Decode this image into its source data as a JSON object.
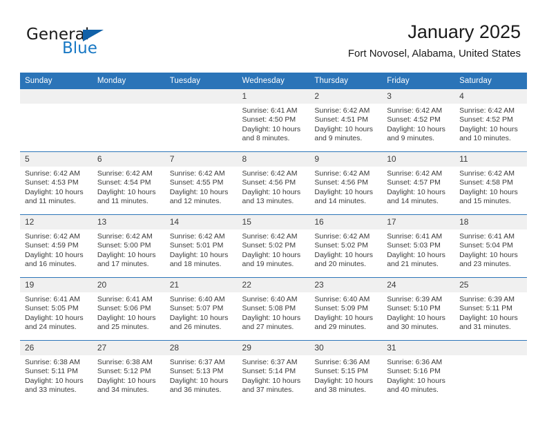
{
  "brand": {
    "name_part1": "General",
    "name_part2": "Blue",
    "flag_icon": "triangle-flag-icon",
    "accent_color": "#1878c4"
  },
  "header": {
    "title": "January 2025",
    "subtitle": "Fort Novosel, Alabama, United States"
  },
  "theme": {
    "header_row_bg": "#2b74b8",
    "daynum_bg": "#f0f0f0",
    "text_color": "#3a3a3a"
  },
  "calendar": {
    "weekday_headers": [
      "Sunday",
      "Monday",
      "Tuesday",
      "Wednesday",
      "Thursday",
      "Friday",
      "Saturday"
    ],
    "weeks": [
      [
        {
          "day": "",
          "sunrise": "",
          "sunset": "",
          "daylight_line1": "",
          "daylight_line2": "",
          "empty": true
        },
        {
          "day": "",
          "sunrise": "",
          "sunset": "",
          "daylight_line1": "",
          "daylight_line2": "",
          "empty": true
        },
        {
          "day": "",
          "sunrise": "",
          "sunset": "",
          "daylight_line1": "",
          "daylight_line2": "",
          "empty": true
        },
        {
          "day": "1",
          "sunrise": "Sunrise: 6:41 AM",
          "sunset": "Sunset: 4:50 PM",
          "daylight_line1": "Daylight: 10 hours",
          "daylight_line2": "and 8 minutes."
        },
        {
          "day": "2",
          "sunrise": "Sunrise: 6:42 AM",
          "sunset": "Sunset: 4:51 PM",
          "daylight_line1": "Daylight: 10 hours",
          "daylight_line2": "and 9 minutes."
        },
        {
          "day": "3",
          "sunrise": "Sunrise: 6:42 AM",
          "sunset": "Sunset: 4:52 PM",
          "daylight_line1": "Daylight: 10 hours",
          "daylight_line2": "and 9 minutes."
        },
        {
          "day": "4",
          "sunrise": "Sunrise: 6:42 AM",
          "sunset": "Sunset: 4:52 PM",
          "daylight_line1": "Daylight: 10 hours",
          "daylight_line2": "and 10 minutes."
        }
      ],
      [
        {
          "day": "5",
          "sunrise": "Sunrise: 6:42 AM",
          "sunset": "Sunset: 4:53 PM",
          "daylight_line1": "Daylight: 10 hours",
          "daylight_line2": "and 11 minutes."
        },
        {
          "day": "6",
          "sunrise": "Sunrise: 6:42 AM",
          "sunset": "Sunset: 4:54 PM",
          "daylight_line1": "Daylight: 10 hours",
          "daylight_line2": "and 11 minutes."
        },
        {
          "day": "7",
          "sunrise": "Sunrise: 6:42 AM",
          "sunset": "Sunset: 4:55 PM",
          "daylight_line1": "Daylight: 10 hours",
          "daylight_line2": "and 12 minutes."
        },
        {
          "day": "8",
          "sunrise": "Sunrise: 6:42 AM",
          "sunset": "Sunset: 4:56 PM",
          "daylight_line1": "Daylight: 10 hours",
          "daylight_line2": "and 13 minutes."
        },
        {
          "day": "9",
          "sunrise": "Sunrise: 6:42 AM",
          "sunset": "Sunset: 4:56 PM",
          "daylight_line1": "Daylight: 10 hours",
          "daylight_line2": "and 14 minutes."
        },
        {
          "day": "10",
          "sunrise": "Sunrise: 6:42 AM",
          "sunset": "Sunset: 4:57 PM",
          "daylight_line1": "Daylight: 10 hours",
          "daylight_line2": "and 14 minutes."
        },
        {
          "day": "11",
          "sunrise": "Sunrise: 6:42 AM",
          "sunset": "Sunset: 4:58 PM",
          "daylight_line1": "Daylight: 10 hours",
          "daylight_line2": "and 15 minutes."
        }
      ],
      [
        {
          "day": "12",
          "sunrise": "Sunrise: 6:42 AM",
          "sunset": "Sunset: 4:59 PM",
          "daylight_line1": "Daylight: 10 hours",
          "daylight_line2": "and 16 minutes."
        },
        {
          "day": "13",
          "sunrise": "Sunrise: 6:42 AM",
          "sunset": "Sunset: 5:00 PM",
          "daylight_line1": "Daylight: 10 hours",
          "daylight_line2": "and 17 minutes."
        },
        {
          "day": "14",
          "sunrise": "Sunrise: 6:42 AM",
          "sunset": "Sunset: 5:01 PM",
          "daylight_line1": "Daylight: 10 hours",
          "daylight_line2": "and 18 minutes."
        },
        {
          "day": "15",
          "sunrise": "Sunrise: 6:42 AM",
          "sunset": "Sunset: 5:02 PM",
          "daylight_line1": "Daylight: 10 hours",
          "daylight_line2": "and 19 minutes."
        },
        {
          "day": "16",
          "sunrise": "Sunrise: 6:42 AM",
          "sunset": "Sunset: 5:02 PM",
          "daylight_line1": "Daylight: 10 hours",
          "daylight_line2": "and 20 minutes."
        },
        {
          "day": "17",
          "sunrise": "Sunrise: 6:41 AM",
          "sunset": "Sunset: 5:03 PM",
          "daylight_line1": "Daylight: 10 hours",
          "daylight_line2": "and 21 minutes."
        },
        {
          "day": "18",
          "sunrise": "Sunrise: 6:41 AM",
          "sunset": "Sunset: 5:04 PM",
          "daylight_line1": "Daylight: 10 hours",
          "daylight_line2": "and 23 minutes."
        }
      ],
      [
        {
          "day": "19",
          "sunrise": "Sunrise: 6:41 AM",
          "sunset": "Sunset: 5:05 PM",
          "daylight_line1": "Daylight: 10 hours",
          "daylight_line2": "and 24 minutes."
        },
        {
          "day": "20",
          "sunrise": "Sunrise: 6:41 AM",
          "sunset": "Sunset: 5:06 PM",
          "daylight_line1": "Daylight: 10 hours",
          "daylight_line2": "and 25 minutes."
        },
        {
          "day": "21",
          "sunrise": "Sunrise: 6:40 AM",
          "sunset": "Sunset: 5:07 PM",
          "daylight_line1": "Daylight: 10 hours",
          "daylight_line2": "and 26 minutes."
        },
        {
          "day": "22",
          "sunrise": "Sunrise: 6:40 AM",
          "sunset": "Sunset: 5:08 PM",
          "daylight_line1": "Daylight: 10 hours",
          "daylight_line2": "and 27 minutes."
        },
        {
          "day": "23",
          "sunrise": "Sunrise: 6:40 AM",
          "sunset": "Sunset: 5:09 PM",
          "daylight_line1": "Daylight: 10 hours",
          "daylight_line2": "and 29 minutes."
        },
        {
          "day": "24",
          "sunrise": "Sunrise: 6:39 AM",
          "sunset": "Sunset: 5:10 PM",
          "daylight_line1": "Daylight: 10 hours",
          "daylight_line2": "and 30 minutes."
        },
        {
          "day": "25",
          "sunrise": "Sunrise: 6:39 AM",
          "sunset": "Sunset: 5:11 PM",
          "daylight_line1": "Daylight: 10 hours",
          "daylight_line2": "and 31 minutes."
        }
      ],
      [
        {
          "day": "26",
          "sunrise": "Sunrise: 6:38 AM",
          "sunset": "Sunset: 5:11 PM",
          "daylight_line1": "Daylight: 10 hours",
          "daylight_line2": "and 33 minutes."
        },
        {
          "day": "27",
          "sunrise": "Sunrise: 6:38 AM",
          "sunset": "Sunset: 5:12 PM",
          "daylight_line1": "Daylight: 10 hours",
          "daylight_line2": "and 34 minutes."
        },
        {
          "day": "28",
          "sunrise": "Sunrise: 6:37 AM",
          "sunset": "Sunset: 5:13 PM",
          "daylight_line1": "Daylight: 10 hours",
          "daylight_line2": "and 36 minutes."
        },
        {
          "day": "29",
          "sunrise": "Sunrise: 6:37 AM",
          "sunset": "Sunset: 5:14 PM",
          "daylight_line1": "Daylight: 10 hours",
          "daylight_line2": "and 37 minutes."
        },
        {
          "day": "30",
          "sunrise": "Sunrise: 6:36 AM",
          "sunset": "Sunset: 5:15 PM",
          "daylight_line1": "Daylight: 10 hours",
          "daylight_line2": "and 38 minutes."
        },
        {
          "day": "31",
          "sunrise": "Sunrise: 6:36 AM",
          "sunset": "Sunset: 5:16 PM",
          "daylight_line1": "Daylight: 10 hours",
          "daylight_line2": "and 40 minutes."
        },
        {
          "day": "",
          "sunrise": "",
          "sunset": "",
          "daylight_line1": "",
          "daylight_line2": "",
          "empty": true
        }
      ]
    ]
  }
}
